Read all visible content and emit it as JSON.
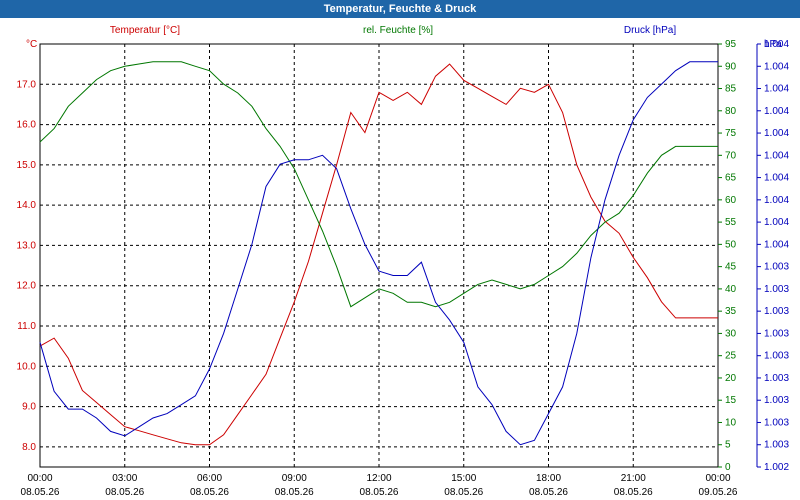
{
  "window": {
    "title": "Temperatur, Feuchte & Druck"
  },
  "chart_data": {
    "type": "line",
    "title": "Temperatur, Feuchte & Druck",
    "x": [
      "00:00\n08.05.26",
      "03:00\n08.05.26",
      "06:00\n08.05.26",
      "09:00\n08.05.26",
      "12:00\n08.05.26",
      "15:00\n08.05.26",
      "18:00\n08.05.26",
      "21:00\n08.05.26",
      "00:00\n09.05.26"
    ],
    "x_hours": [
      0,
      0.5,
      1,
      1.5,
      2,
      2.5,
      3,
      3.5,
      4,
      4.5,
      5,
      5.5,
      6,
      6.5,
      7,
      7.5,
      8,
      8.5,
      9,
      9.5,
      10,
      10.5,
      11,
      11.5,
      12,
      12.5,
      13,
      13.5,
      14,
      14.5,
      15,
      15.5,
      16,
      16.5,
      17,
      17.5,
      18,
      18.5,
      19,
      19.5,
      20,
      20.5,
      21,
      21.5,
      22,
      22.5,
      23,
      23.5,
      24
    ],
    "grid": true,
    "colors": {
      "temperature": "#cc0000",
      "humidity": "#007700",
      "pressure": "#0000bb",
      "title_bar": "#1f66a8"
    },
    "axes": {
      "left": {
        "label": "Temperatur [°C]",
        "unit": "°C",
        "ylim": [
          7.5,
          18.0
        ],
        "ticks": [
          "8.0",
          "9.0",
          "10.0",
          "11.0",
          "12.0",
          "13.0",
          "14.0",
          "15.0",
          "16.0",
          "17.0"
        ]
      },
      "right1": {
        "label": "rel. Feuchte [%]",
        "unit": "%",
        "ylim": [
          0,
          95
        ],
        "ticks": [
          "0",
          "5",
          "10",
          "15",
          "20",
          "25",
          "30",
          "35",
          "40",
          "45",
          "50",
          "55",
          "60",
          "65",
          "70",
          "75",
          "80",
          "85",
          "90",
          "95"
        ]
      },
      "right2": {
        "label": "Druck [hPa]",
        "unit": "hPa",
        "ticks": [
          "1.002",
          "1.003",
          "1.003",
          "1.003",
          "1.003",
          "1.003",
          "1.003",
          "1.003",
          "1.003",
          "1.003",
          "1.004",
          "1.004",
          "1.004",
          "1.004",
          "1.004",
          "1.004",
          "1.004",
          "1.004",
          "1.004",
          "1.004"
        ]
      }
    },
    "series": [
      {
        "name": "Temperatur [°C]",
        "axis": "left",
        "values": [
          10.5,
          10.7,
          10.2,
          9.4,
          9.1,
          8.8,
          8.5,
          8.4,
          8.3,
          8.2,
          8.1,
          8.05,
          8.05,
          8.3,
          8.8,
          9.3,
          9.8,
          10.7,
          11.6,
          12.6,
          13.8,
          15.0,
          16.3,
          15.8,
          16.8,
          16.6,
          16.8,
          16.5,
          17.2,
          17.5,
          17.1,
          16.9,
          16.7,
          16.5,
          16.9,
          16.8,
          17.0,
          16.3,
          15.0,
          14.2,
          13.6,
          13.3,
          12.7,
          12.2,
          11.6,
          11.2,
          11.2,
          11.2,
          11.2
        ]
      },
      {
        "name": "rel. Feuchte [%]",
        "axis": "right1",
        "values": [
          73,
          76,
          81,
          84,
          87,
          89,
          90,
          90.5,
          91,
          91,
          91,
          90,
          89,
          86,
          84,
          81,
          76,
          72,
          67,
          60,
          53,
          45,
          36,
          38,
          40,
          39,
          37,
          37,
          36,
          37,
          39,
          41,
          42,
          41,
          40,
          41,
          43,
          45,
          48,
          52,
          55,
          57,
          61,
          66,
          70,
          72,
          72,
          72,
          72
        ]
      },
      {
        "name": "Druck [hPa]",
        "axis": "right2",
        "values": [
          28,
          17,
          13,
          13,
          11,
          8,
          7,
          9,
          11,
          12,
          14,
          16,
          22,
          30,
          40,
          50,
          63,
          68,
          69,
          69,
          70,
          67,
          58,
          50,
          44,
          43,
          43,
          46,
          37,
          33,
          28,
          18,
          14,
          8,
          5,
          6,
          12,
          18,
          30,
          47,
          60,
          70,
          78,
          83,
          86,
          89,
          91,
          91,
          91
        ]
      }
    ]
  }
}
